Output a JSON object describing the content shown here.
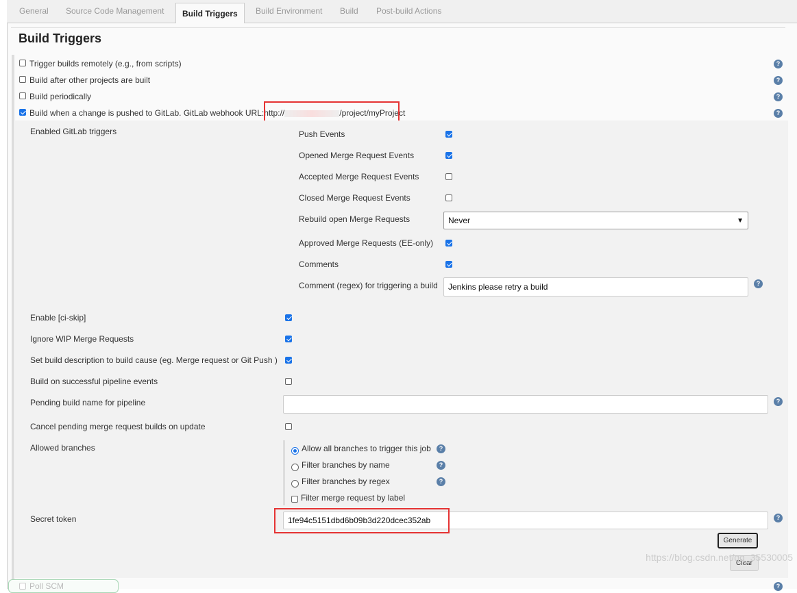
{
  "tabs": [
    {
      "label": "General"
    },
    {
      "label": "Source Code Management"
    },
    {
      "label": "Build Triggers",
      "active": true
    },
    {
      "label": "Build Environment"
    },
    {
      "label": "Build"
    },
    {
      "label": "Post-build Actions"
    }
  ],
  "section_title": "Build Triggers",
  "triggers": [
    {
      "label": "Trigger builds remotely (e.g., from scripts)",
      "checked": false
    },
    {
      "label": "Build after other projects are built",
      "checked": false
    },
    {
      "label": "Build periodically",
      "checked": false
    },
    {
      "label": "Build when a change is pushed to GitLab. GitLab webhook URL:",
      "checked": true
    }
  ],
  "webhook": {
    "prefix": "http://",
    "suffix": "/project/myProject"
  },
  "gitlab": {
    "enabled_label": "Enabled GitLab triggers",
    "events": [
      {
        "label": "Push Events",
        "checked": true
      },
      {
        "label": "Opened Merge Request Events",
        "checked": true
      },
      {
        "label": "Accepted Merge Request Events",
        "checked": false
      },
      {
        "label": "Closed Merge Request Events",
        "checked": false
      }
    ],
    "rebuild_label": "Rebuild open Merge Requests",
    "rebuild_value": "Never",
    "approved": {
      "label": "Approved Merge Requests (EE-only)",
      "checked": true
    },
    "comments": {
      "label": "Comments",
      "checked": true
    },
    "comment_regex_label": "Comment (regex) for triggering a build",
    "comment_regex_value": "Jenkins please retry a build",
    "options": [
      {
        "label": "Enable [ci-skip]",
        "checked": true
      },
      {
        "label": "Ignore WIP Merge Requests",
        "checked": true
      },
      {
        "label": "Set build description to build cause (eg. Merge request or Git Push )",
        "checked": true
      },
      {
        "label": "Build on successful pipeline events",
        "checked": false
      }
    ],
    "pending_label": "Pending build name for pipeline",
    "pending_value": "",
    "cancel_label": "Cancel pending merge request builds on update",
    "cancel_checked": false,
    "branches_label": "Allowed branches",
    "branches": [
      {
        "label": "Allow all branches to trigger this job",
        "selected": true
      },
      {
        "label": "Filter branches by name",
        "selected": false
      },
      {
        "label": "Filter branches by regex",
        "selected": false
      }
    ],
    "label_filter": {
      "label": "Filter merge request by label",
      "checked": false
    },
    "secret_label": "Secret token",
    "secret_value": "1fe94c5151dbd6b09b3d220dcec352ab",
    "generate": "Generate",
    "clear": "Clear"
  },
  "poll_scm": "Poll SCM",
  "watermark": "https://blog.csdn.net/qq_35530005",
  "help": "?"
}
